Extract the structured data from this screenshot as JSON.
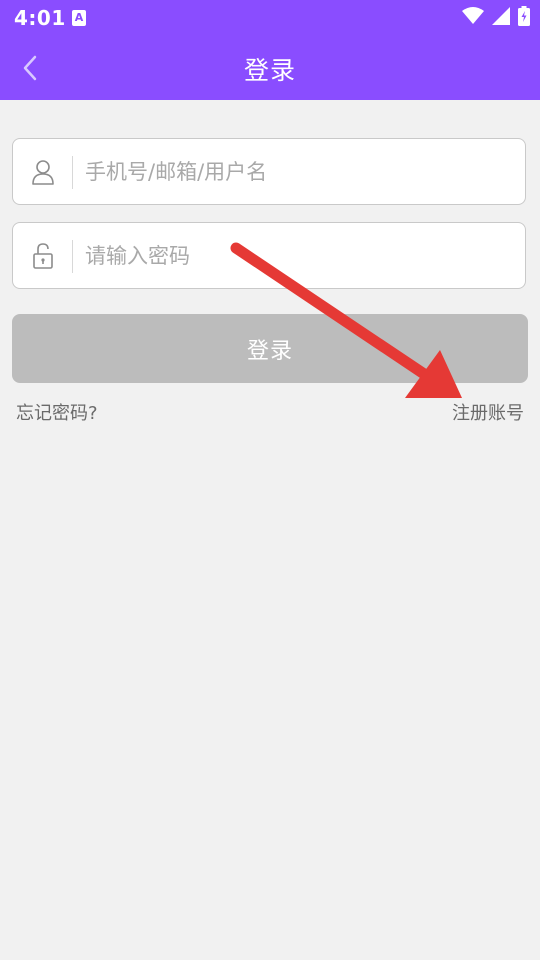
{
  "status_bar": {
    "time": "4:01",
    "notification_icon": "a-text-icon",
    "notification_letter": "A",
    "icons": [
      "wifi-icon",
      "signal-icon",
      "battery-charging-icon"
    ]
  },
  "header": {
    "title": "登录",
    "back_icon": "chevron-left-icon",
    "background_color": "#8a4dff"
  },
  "form": {
    "username": {
      "icon": "user-icon",
      "placeholder": "手机号/邮箱/用户名",
      "value": ""
    },
    "password": {
      "icon": "lock-open-icon",
      "placeholder": "请输入密码",
      "value": ""
    },
    "login_button_label": "登录",
    "login_button_color": "#bcbcbc"
  },
  "links": {
    "forgot_password": "忘记密码?",
    "register": "注册账号"
  },
  "annotation": {
    "arrow_icon": "red-arrow-icon",
    "color": "#e53935"
  }
}
